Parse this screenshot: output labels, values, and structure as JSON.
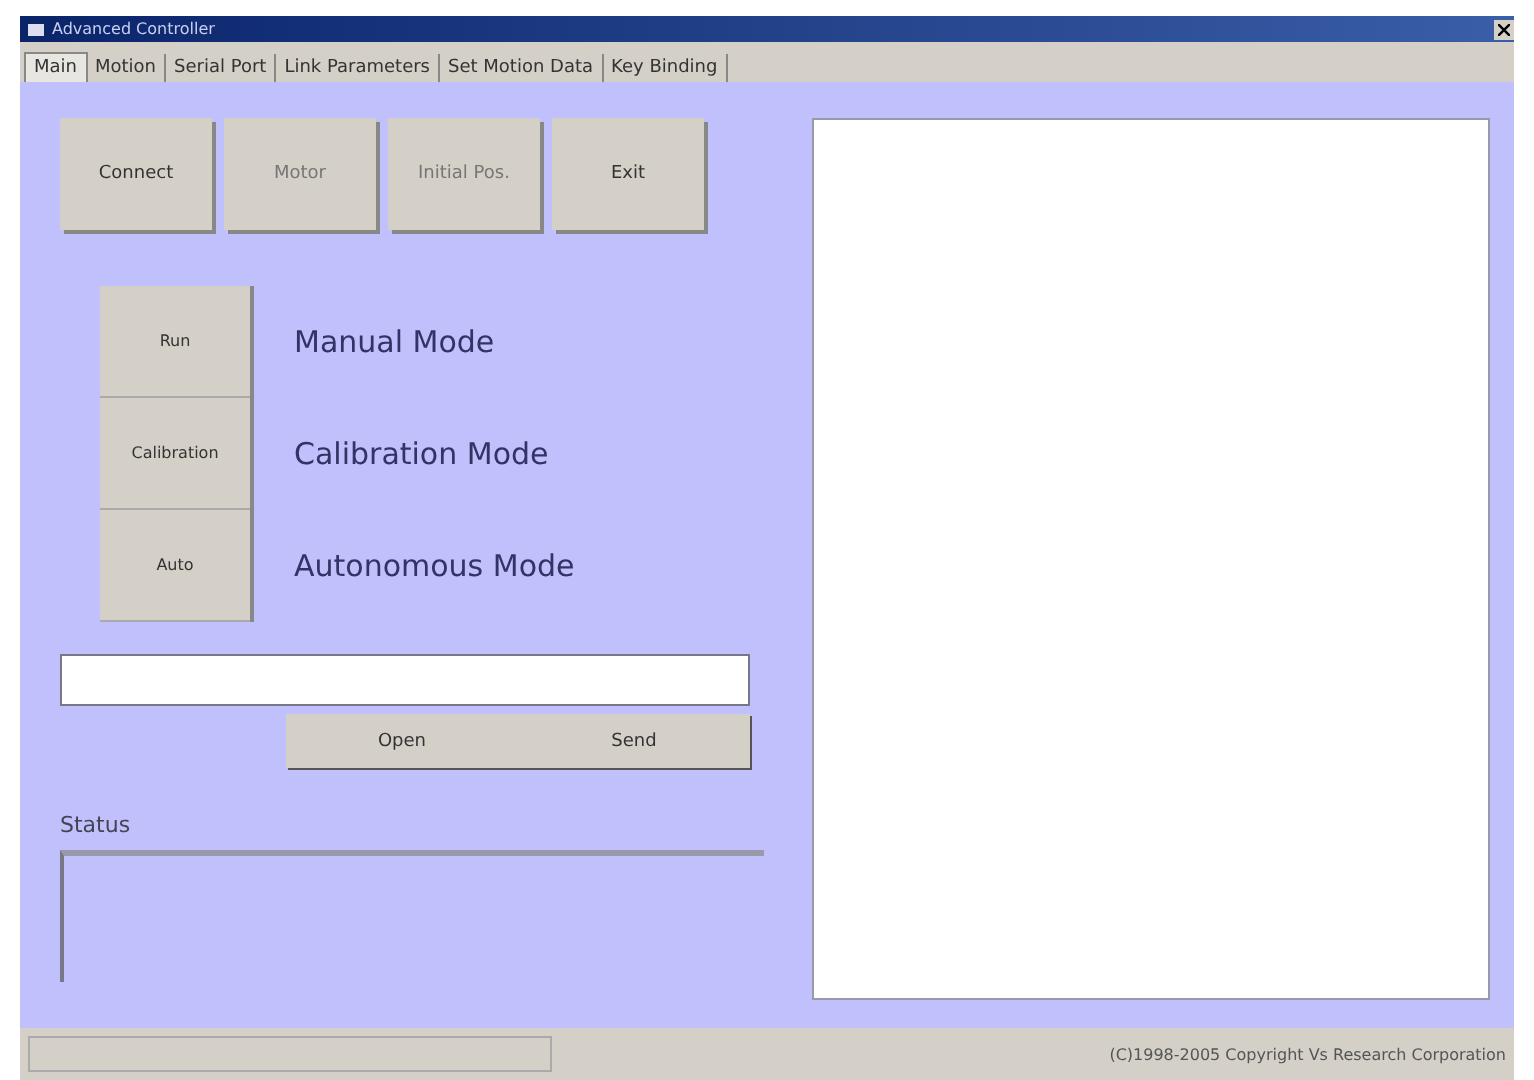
{
  "window": {
    "title": "Advanced Controller"
  },
  "tabs": [
    {
      "label": "Main",
      "selected": true
    },
    {
      "label": "Motion",
      "selected": false
    },
    {
      "label": "Serial Port",
      "selected": false
    },
    {
      "label": "Link Parameters",
      "selected": false
    },
    {
      "label": "Set Motion Data",
      "selected": false
    },
    {
      "label": "Key Binding",
      "selected": false
    }
  ],
  "top_buttons": [
    {
      "label": "Connect",
      "disabled": false
    },
    {
      "label": "Motor",
      "disabled": true
    },
    {
      "label": "Initial Pos.",
      "disabled": true
    },
    {
      "label": "Exit",
      "disabled": false
    }
  ],
  "modes": [
    {
      "button": "Run",
      "label": "Manual Mode"
    },
    {
      "button": "Calibration",
      "label": "Calibration Mode"
    },
    {
      "button": "Auto",
      "label": "Autonomous Mode"
    }
  ],
  "file_buttons": [
    "Open",
    "Send"
  ],
  "status": {
    "label": "Status"
  },
  "status_bar": {
    "copyright": "(C)1998-2005 Copyright Vs Research Corporation"
  }
}
